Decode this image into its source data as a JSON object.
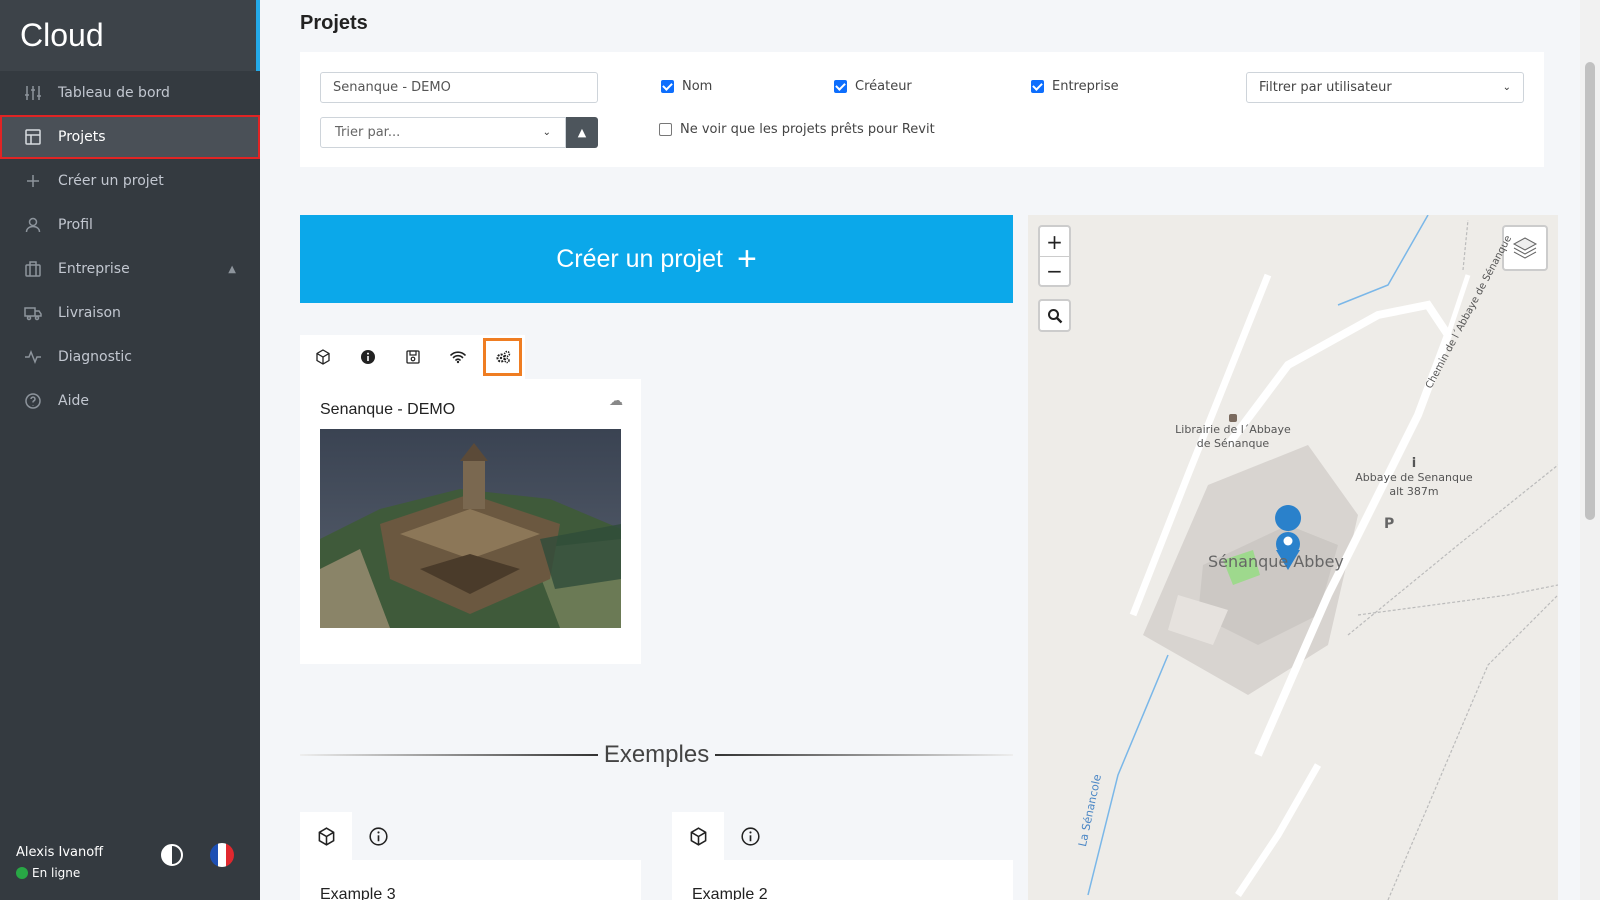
{
  "brand": "Cloud",
  "nav": [
    {
      "label": "Tableau de bord",
      "icon": "sliders-icon"
    },
    {
      "label": "Projets",
      "icon": "layout-icon",
      "active": true
    },
    {
      "label": "Créer un projet",
      "icon": "plus-icon"
    },
    {
      "label": "Profil",
      "icon": "user-icon"
    },
    {
      "label": "Entreprise",
      "icon": "building-icon",
      "caret": "^"
    },
    {
      "label": "Livraison",
      "icon": "truck-icon"
    },
    {
      "label": "Diagnostic",
      "icon": "activity-icon"
    },
    {
      "label": "Aide",
      "icon": "help-circle-icon"
    }
  ],
  "user": {
    "name": "Alexis Ivanoff",
    "status": "En ligne"
  },
  "page_title": "Projets",
  "filters": {
    "search_value": "Senanque - DEMO",
    "sort_placeholder": "Trier par...",
    "checkbox_nom": "Nom",
    "checkbox_createur": "Créateur",
    "checkbox_entreprise": "Entreprise",
    "checkbox_revit": "Ne voir que les projets prêts pour Revit",
    "user_filter": "Filtrer par utilisateur"
  },
  "create_button": "Créer un projet",
  "project": {
    "title": "Senanque - DEMO"
  },
  "examples_heading": "Exemples",
  "examples": [
    {
      "title": "Example 3"
    },
    {
      "title": "Example 2"
    }
  ],
  "map": {
    "labels": {
      "librairie_1": "Librairie de l´Abbaye",
      "librairie_2": "de Sénanque",
      "abbaye_1": "Abbaye de Senanque",
      "abbaye_2": "alt 387m",
      "parking": "P",
      "main": "Sénanque Abbey",
      "chemin": "Chemin de l´Abbaye de Sénanque",
      "senancole": "La Sénancole"
    }
  },
  "colors": {
    "accent": "#0ba8ea",
    "active_outline": "#e02424",
    "tab_highlight": "#ef7d22",
    "sidebar": "#343a40"
  }
}
